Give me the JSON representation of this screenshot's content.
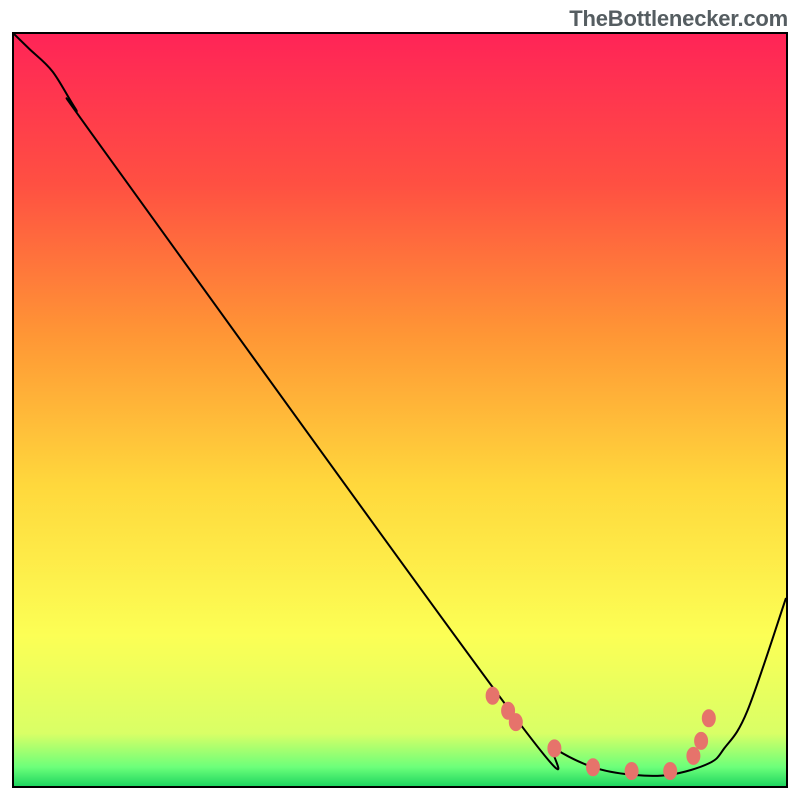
{
  "watermark_text": "TheBottlenecker.com",
  "chart_data": {
    "type": "line",
    "title": "",
    "xlabel": "",
    "ylabel": "",
    "xlim": [
      0,
      100
    ],
    "ylim": [
      0,
      100
    ],
    "x": [
      0,
      2,
      5,
      8,
      12,
      65,
      70,
      75,
      80,
      85,
      90,
      92,
      95,
      100
    ],
    "y": [
      100,
      98,
      95,
      90,
      84,
      9,
      5,
      2.5,
      1.5,
      1.5,
      3,
      5,
      10,
      25
    ],
    "markers_x": [
      62,
      64,
      65,
      70,
      75,
      80,
      85,
      88,
      89,
      90
    ],
    "markers_y": [
      12,
      10,
      8.5,
      5,
      2.5,
      2,
      2,
      4,
      6,
      9
    ],
    "marker_color": "#e6736b",
    "curve_color": "#000000",
    "gradient_stops": [
      {
        "p": 0.0,
        "c": "#ff2457"
      },
      {
        "p": 0.2,
        "c": "#ff5042"
      },
      {
        "p": 0.4,
        "c": "#ff9635"
      },
      {
        "p": 0.6,
        "c": "#ffd83c"
      },
      {
        "p": 0.8,
        "c": "#fcff55"
      },
      {
        "p": 0.93,
        "c": "#d9ff66"
      },
      {
        "p": 0.975,
        "c": "#6cff7a"
      },
      {
        "p": 1.0,
        "c": "#1fd660"
      }
    ]
  }
}
